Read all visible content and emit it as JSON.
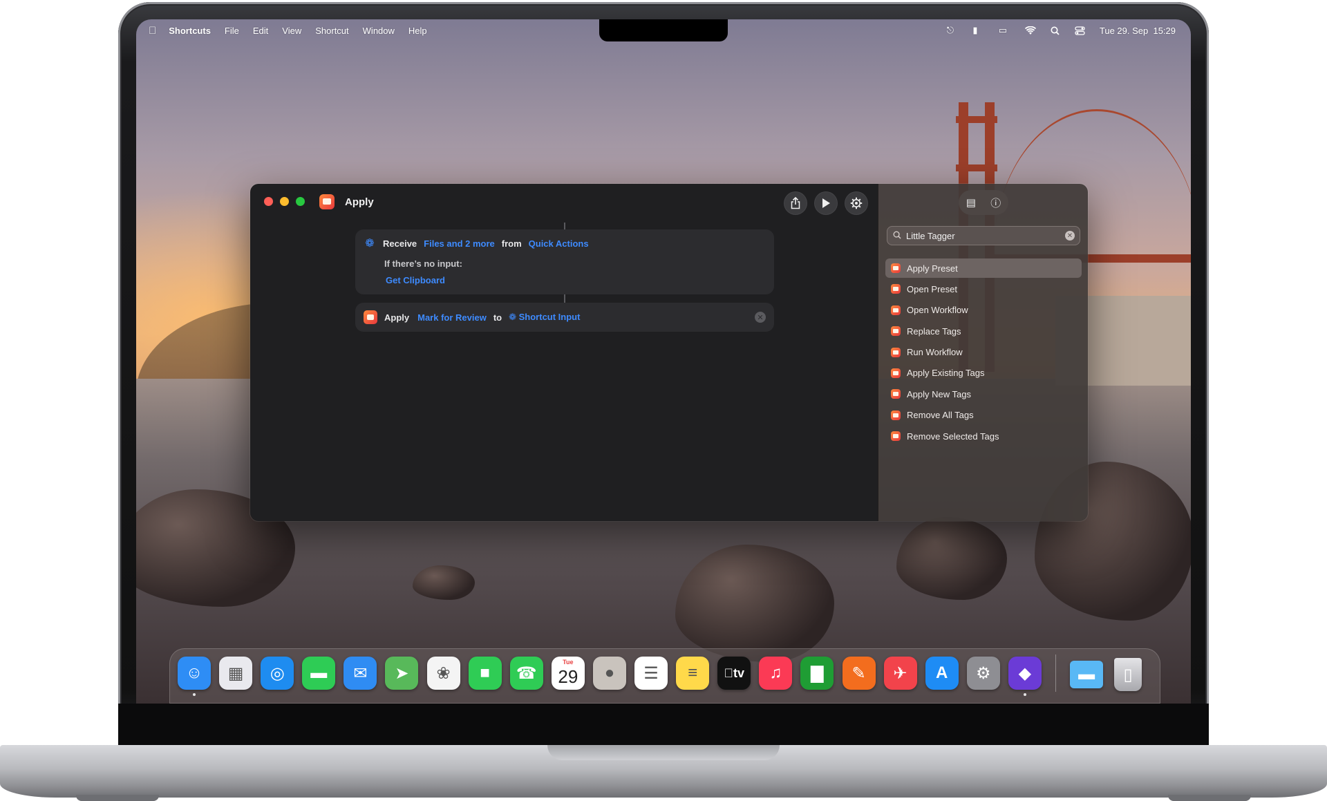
{
  "menubar": {
    "apple_icon": "apple-icon",
    "app_name": "Shortcuts",
    "items": [
      "File",
      "Edit",
      "View",
      "Shortcut",
      "Window",
      "Help"
    ],
    "clock": "Tue 29. Sep  15:29",
    "status_icons": [
      "screen-mirroring-icon",
      "document-icon",
      "battery-charging-icon",
      "wifi-icon",
      "spotlight-search-icon",
      "control-center-icon"
    ]
  },
  "window": {
    "title": "Apply",
    "toolbar": [
      "share-icon",
      "play-icon",
      "settings-icon"
    ],
    "receive": {
      "verb": "Receive",
      "types": "Files and 2 more",
      "from_label": "from",
      "source": "Quick Actions",
      "no_input_label": "If there’s no input:",
      "no_input_action": "Get Clipboard"
    },
    "apply": {
      "verb": "Apply",
      "preset": "Mark for Review",
      "to_label": "to",
      "input": "Shortcut Input"
    }
  },
  "sidebar": {
    "segment_icons": [
      "library-icon",
      "info-icon"
    ],
    "search_value": "Little Tagger",
    "actions": [
      "Apply Preset",
      "Open Preset",
      "Open Workflow",
      "Replace Tags",
      "Run Workflow",
      "Apply Existing Tags",
      "Apply New Tags",
      "Remove All Tags",
      "Remove Selected Tags"
    ],
    "selected_index": 0
  },
  "dock": {
    "apps": [
      {
        "name": "finder-icon",
        "color": "#2e8df5"
      },
      {
        "name": "launchpad-icon",
        "color": "#e9e9ee"
      },
      {
        "name": "safari-icon",
        "color": "#1e8cf0"
      },
      {
        "name": "messages-icon",
        "color": "#2ecc55"
      },
      {
        "name": "mail-icon",
        "color": "#2f8cf3"
      },
      {
        "name": "maps-icon",
        "color": "#58b95a"
      },
      {
        "name": "photos-icon",
        "color": "#f4f4f4"
      },
      {
        "name": "facetime-icon",
        "color": "#2fcc55"
      },
      {
        "name": "phone-icon",
        "color": "#2fcc55"
      },
      {
        "name": "calendar-icon",
        "color": "#ffffff",
        "day": "Tue",
        "date": "29"
      },
      {
        "name": "contacts-icon",
        "color": "#c9c3bd"
      },
      {
        "name": "reminders-icon",
        "color": "#ffffff"
      },
      {
        "name": "notes-icon",
        "color": "#ffd94a"
      },
      {
        "name": "tv-icon",
        "color": "#111111",
        "label": "tv"
      },
      {
        "name": "music-icon",
        "color": "#fb3a55"
      },
      {
        "name": "numbers-icon",
        "color": "#1f9d34"
      },
      {
        "name": "pages-icon",
        "color": "#f36d1e"
      },
      {
        "name": "rocket-typist-icon",
        "color": "#f2434b"
      },
      {
        "name": "app-store-icon",
        "color": "#1e8cf5"
      },
      {
        "name": "system-settings-icon",
        "color": "#8e8e93"
      },
      {
        "name": "shortcuts-icon",
        "color": "#6b3bd6"
      }
    ],
    "trailing": [
      {
        "name": "folder-icon",
        "color": "#59b8f5"
      },
      {
        "name": "trash-icon",
        "color": "#c9c9cc"
      }
    ]
  }
}
